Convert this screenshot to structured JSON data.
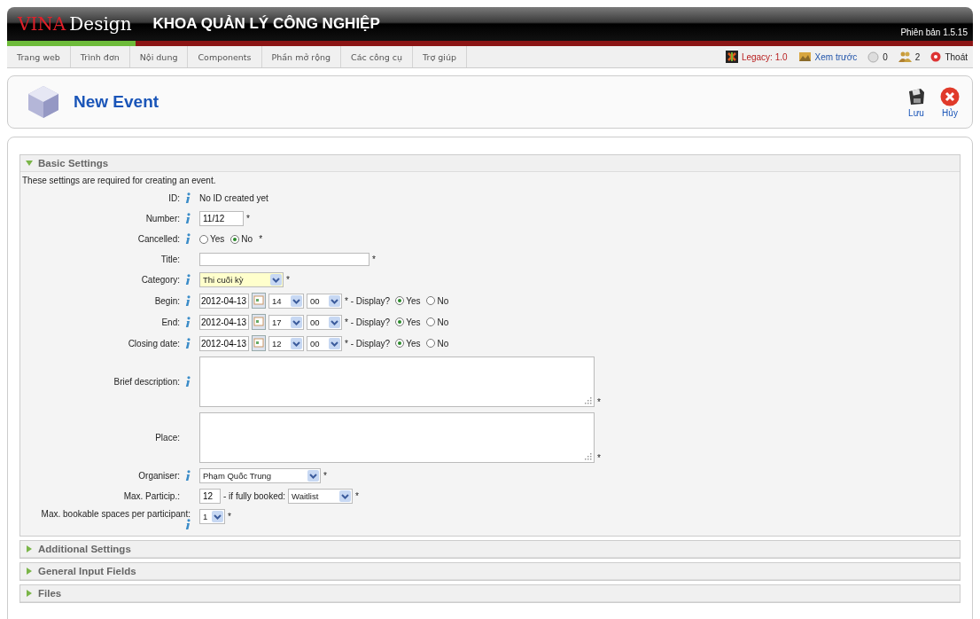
{
  "header": {
    "logo_red": "VINA",
    "logo_white": "Design",
    "site_title": "KHOA QUẢN LÝ CÔNG NGHIỆP",
    "version": "Phiên bản 1.5.15"
  },
  "menu": [
    {
      "label": "Trang web"
    },
    {
      "label": "Trình đơn"
    },
    {
      "label": "Nội dung"
    },
    {
      "label": "Components"
    },
    {
      "label": "Phần mở rộng"
    },
    {
      "label": "Các công cụ"
    },
    {
      "label": "Trợ giúp"
    }
  ],
  "status": {
    "legacy": "Legacy: 1.0",
    "preview": "Xem trước",
    "messages": "0",
    "users": "2",
    "logout": "Thoát"
  },
  "toolbar": {
    "title": "New Event",
    "buttons": [
      {
        "kind": "save",
        "label": "Lưu"
      },
      {
        "kind": "cancel",
        "label": "Hủy"
      }
    ]
  },
  "sections": [
    {
      "title": "Basic Settings",
      "expanded": true
    },
    {
      "title": "Additional Settings",
      "expanded": false
    },
    {
      "title": "General Input Fields",
      "expanded": false
    },
    {
      "title": "Files",
      "expanded": false
    }
  ],
  "intro": "These settings are required for creating an event.",
  "rows": [
    {
      "kind": "text",
      "label": "ID:",
      "info": true,
      "value": "No ID created yet"
    },
    {
      "kind": "input",
      "label": "Number:",
      "info": true,
      "value": "11/12",
      "required": "*"
    },
    {
      "kind": "radio",
      "label": "Cancelled:",
      "info": true,
      "options": [
        {
          "label": "Yes",
          "selected": false
        },
        {
          "label": "No",
          "selected": true
        }
      ],
      "required": "*"
    },
    {
      "kind": "long-input",
      "label": "Title:",
      "info": false,
      "value": "",
      "required": "*"
    },
    {
      "kind": "select",
      "label": "Category:",
      "info": true,
      "value": "Thi cuối kỳ",
      "highlighted": true,
      "required": "*"
    },
    {
      "kind": "datetime",
      "label": "Begin:",
      "info": true,
      "date": "2012-04-13",
      "hour": "14",
      "minute": "00",
      "display_label": "* - Display?",
      "options": [
        {
          "label": "Yes",
          "selected": true
        },
        {
          "label": "No",
          "selected": false
        }
      ]
    },
    {
      "kind": "datetime",
      "label": "End:",
      "info": true,
      "date": "2012-04-13",
      "hour": "17",
      "minute": "00",
      "display_label": "* - Display?",
      "options": [
        {
          "label": "Yes",
          "selected": true
        },
        {
          "label": "No",
          "selected": false
        }
      ]
    },
    {
      "kind": "datetime",
      "label": "Closing date:",
      "info": true,
      "date": "2012-04-13",
      "hour": "12",
      "minute": "00",
      "display_label": "* - Display?",
      "options": [
        {
          "label": "Yes",
          "selected": true
        },
        {
          "label": "No",
          "selected": false
        }
      ]
    },
    {
      "kind": "textarea",
      "label": "Brief description:",
      "info": true,
      "required": "*"
    },
    {
      "kind": "textarea",
      "label": "Place:",
      "info": false,
      "required": "*"
    },
    {
      "kind": "select",
      "label": "Organiser:",
      "info": true,
      "value": "Phạm Quốc Trung",
      "highlighted": false,
      "required": "*"
    },
    {
      "kind": "participants",
      "label": "Max. Particip.:",
      "info": false,
      "value": "12",
      "booked_label": "- if fully booked:",
      "booked_value": "Waitlist",
      "required": "*"
    },
    {
      "kind": "tiny-select",
      "label": "Max. bookable spaces per participant:",
      "info": true,
      "value": "1",
      "required": "*"
    }
  ]
}
